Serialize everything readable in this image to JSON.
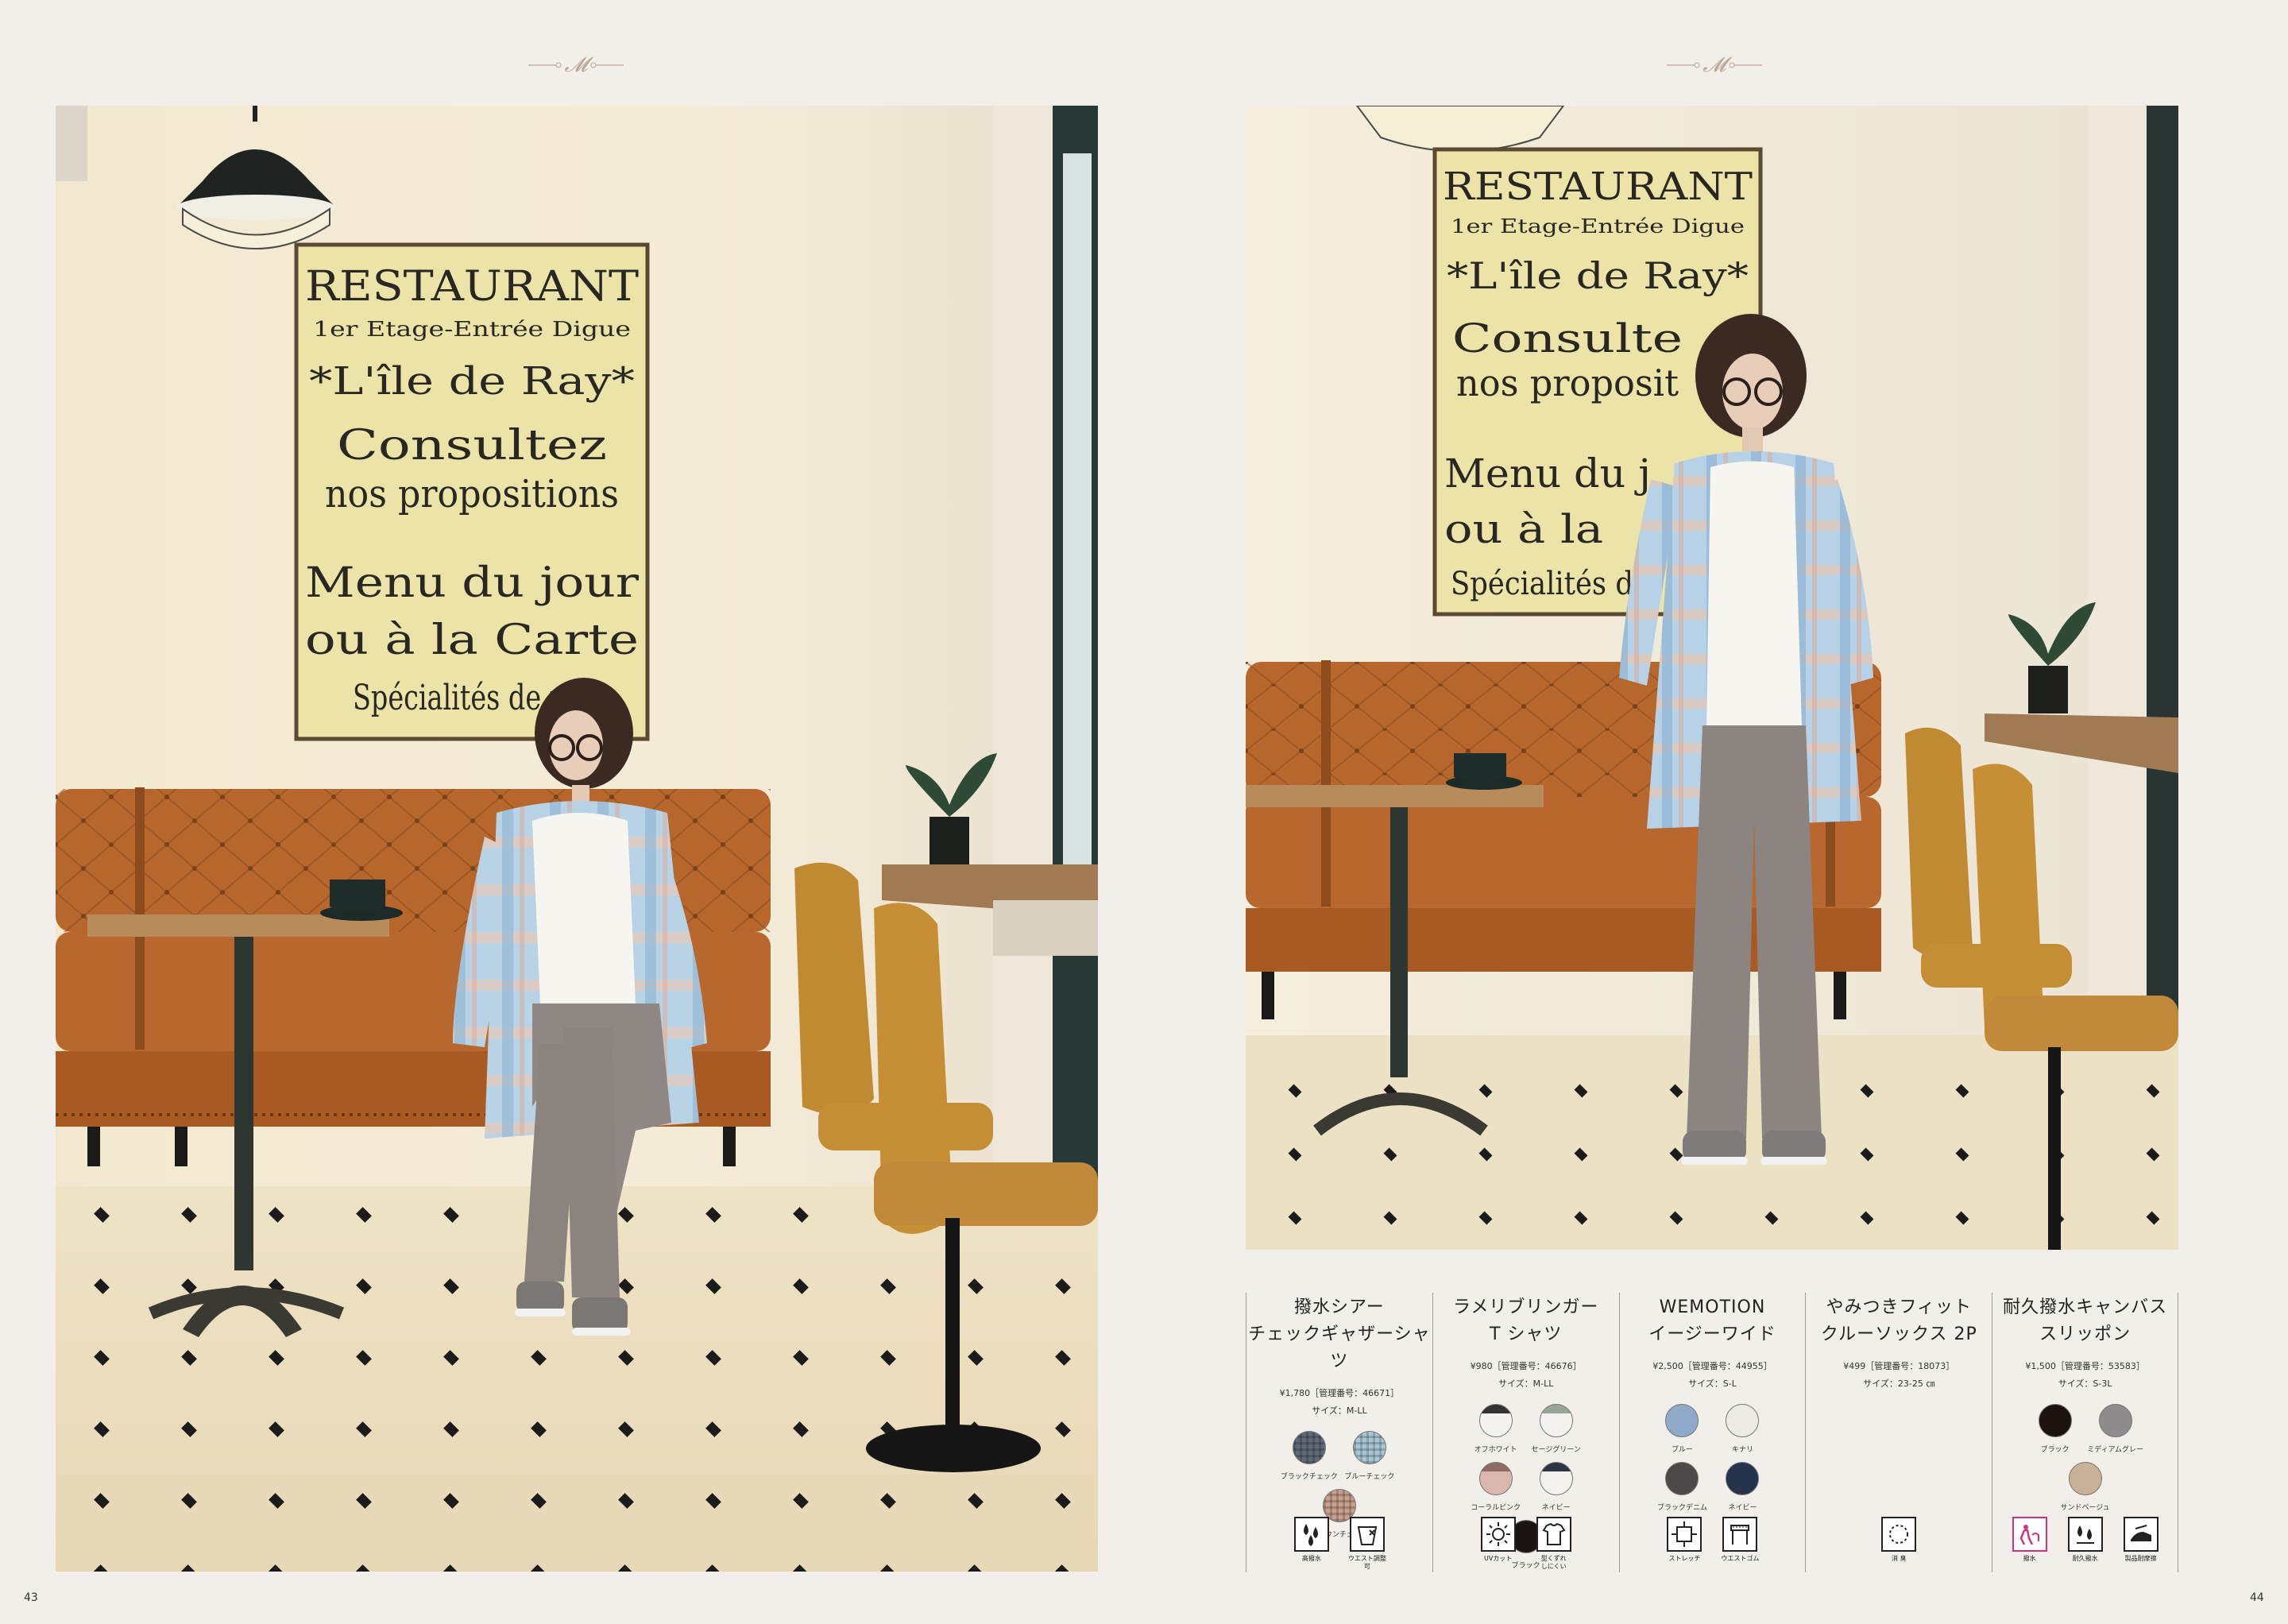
{
  "page_numbers": {
    "left": "43",
    "right": "44"
  },
  "left_photo": {
    "sign_lines": [
      "RESTAURANT",
      "1er Etage-Entrée Digue",
      "*L'île de Ray*",
      "Consultez",
      "nos propositions",
      "Menu du jour",
      "ou à la Carte",
      "Spécialités de poi"
    ]
  },
  "right_photo": {
    "sign_lines": [
      "RESTAURANT",
      "1er Etage-Entrée Digue",
      "*L'île de Ray*",
      "Consulte",
      "nos proposit",
      "Menu du j",
      "ou à la",
      "Spécialités d"
    ]
  },
  "products": [
    {
      "name_line1": "撥水シアー",
      "name_line2": "チェックギャザーシャツ",
      "price": "¥1,780［管理番号：46671］",
      "size": "サイズ：M-LL",
      "swatches": [
        {
          "label": "ブラックチェック",
          "color": "#5e6a78",
          "pattern": "check"
        },
        {
          "label": "ブルーチェック",
          "color": "#a9c8d6",
          "pattern": "check"
        },
        {
          "label": "ブラウンチェック",
          "color": "#c9a08e",
          "pattern": "check"
        }
      ],
      "features": [
        {
          "icon": "water-repellent-icon",
          "label": "高撥水"
        },
        {
          "icon": "waist-adjust-icon",
          "label": "ウエスト調整可"
        }
      ]
    },
    {
      "name_line1": "ラメリブリンガー",
      "name_line2": "T シャツ",
      "price": "¥980［管理番号：46676］",
      "size": "サイズ：M-LL",
      "swatches": [
        {
          "label": "オフホワイト",
          "color": "#f4f2ee",
          "trim": "#333333"
        },
        {
          "label": "セージグリーン",
          "color": "#f4f2ee",
          "trim": "#9aa496"
        },
        {
          "label": "コーラルピンク",
          "color": "#d9b7ad",
          "trim": "#8e6a63"
        },
        {
          "label": "ネイビー",
          "color": "#f4f2ee",
          "trim": "#2c3446"
        },
        {
          "label": "ブラック",
          "color": "#1b1414",
          "trim": "#1b1414"
        }
      ],
      "features": [
        {
          "icon": "uv-cut-icon",
          "label": "UVカット"
        },
        {
          "icon": "shape-keep-icon",
          "label": "型くずれ\nしにくい"
        }
      ]
    },
    {
      "name_line1": "WEMOTION",
      "name_line2": "イージーワイド",
      "price": "¥2,500［管理番号：44955］",
      "size": "サイズ：S-L",
      "swatches": [
        {
          "label": "ブルー",
          "color": "#8fa9c8"
        },
        {
          "label": "キナリ",
          "color": "#ecebe6"
        },
        {
          "label": "ブラックデニム",
          "color": "#4b4a48"
        },
        {
          "label": "ネイビー",
          "color": "#25344c"
        }
      ],
      "features": [
        {
          "icon": "stretch-icon",
          "label": "ストレッチ"
        },
        {
          "icon": "waist-rubber-icon",
          "label": "ウエストゴム"
        }
      ]
    },
    {
      "name_line1": "やみつきフィット",
      "name_line2": "クルーソックス 2P",
      "price": "¥499［管理番号：18073］",
      "size": "サイズ：23-25 ㎝",
      "swatches": [],
      "features": [
        {
          "icon": "deodorant-icon",
          "label": "消 臭"
        }
      ]
    },
    {
      "name_line1": "耐久撥水キャンバス",
      "name_line2": "スリッポン",
      "price": "¥1,500［管理番号：53583］",
      "size": "サイズ：S-3L",
      "swatches": [
        {
          "label": "ブラック",
          "color": "#1c1210"
        },
        {
          "label": "ミディアムグレー",
          "color": "#8e8c8c"
        },
        {
          "label": "サンドベージュ",
          "color": "#c8b196"
        }
      ],
      "features": [
        {
          "icon": "care-icon",
          "label": "撥水",
          "pink": true
        },
        {
          "icon": "durable-water-icon",
          "label": "耐久撥水"
        },
        {
          "icon": "comfort-icon",
          "label": "製品耐摩擦"
        }
      ]
    }
  ]
}
